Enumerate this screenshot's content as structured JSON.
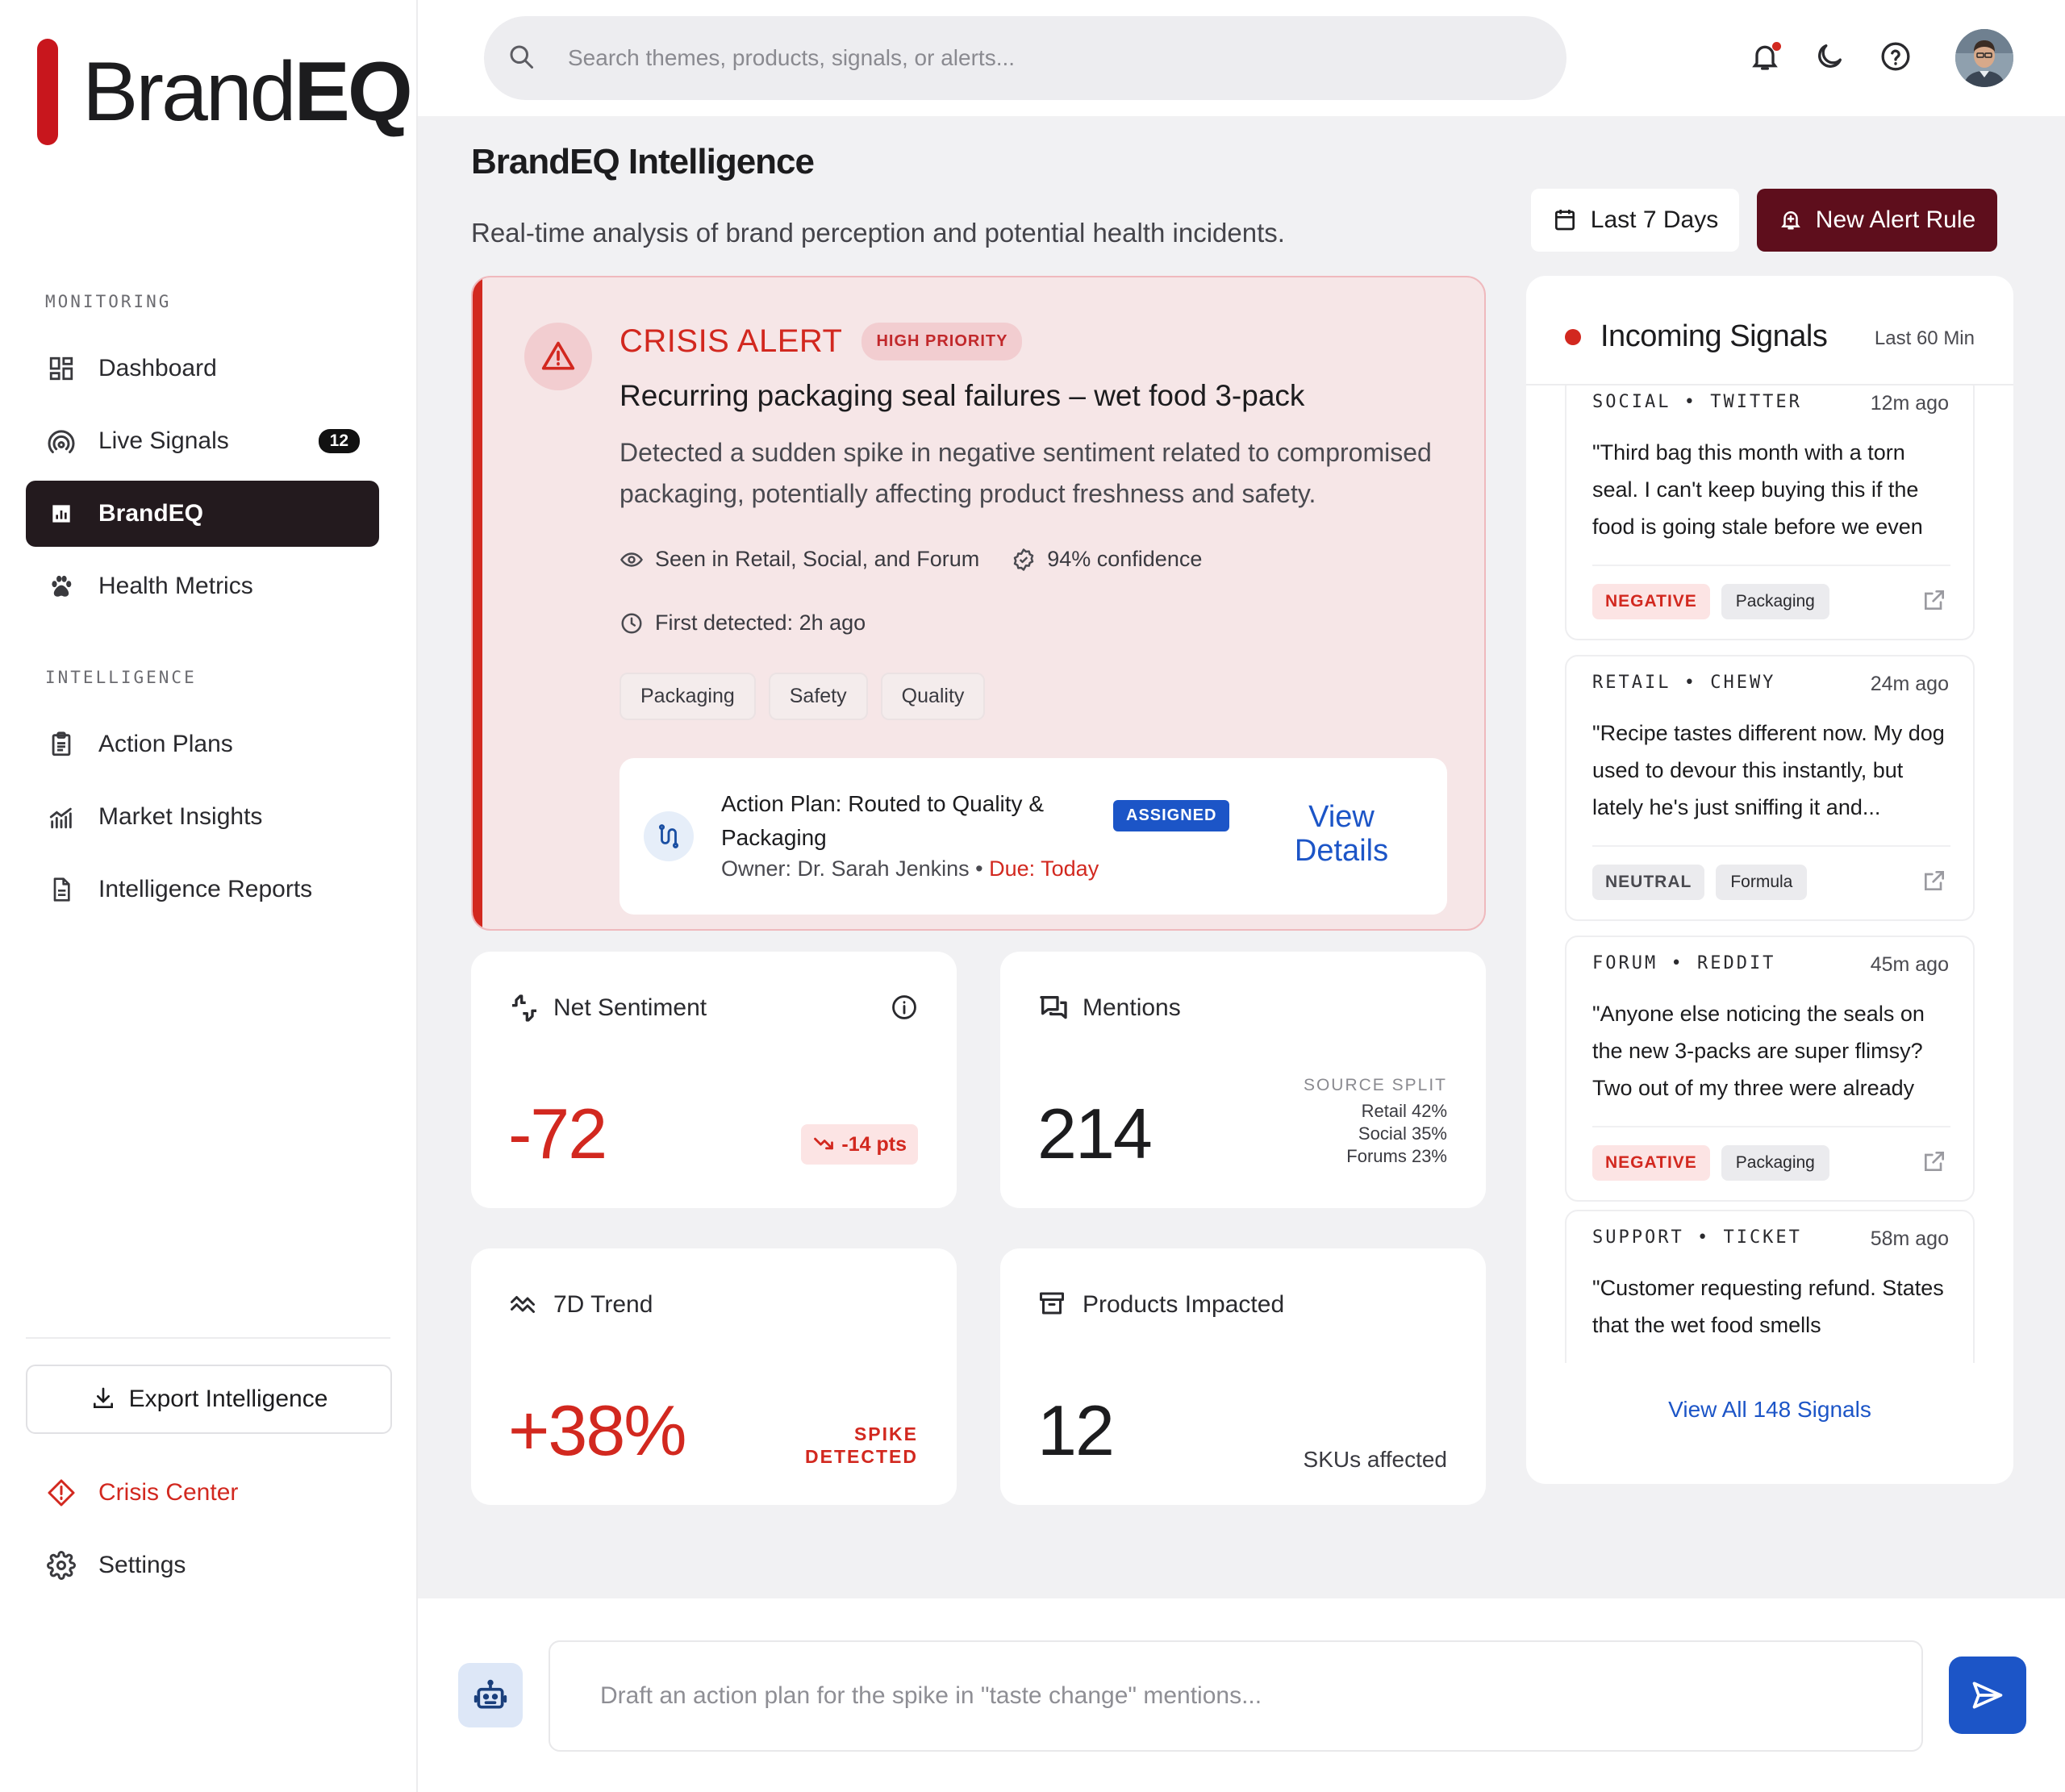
{
  "brand": {
    "name_regular": "Brand",
    "name_bold": "EQ",
    "accent": "#c8161d"
  },
  "sidebar": {
    "monitoring_label": "MONITORING",
    "intelligence_label": "INTELLIGENCE",
    "monitoring_items": [
      {
        "label": "Dashboard",
        "icon": "dashboard-icon"
      },
      {
        "label": "Live Signals",
        "icon": "signal-icon",
        "badge": "12"
      },
      {
        "label": "BrandEQ",
        "icon": "bar-chart-icon",
        "active": true
      },
      {
        "label": "Health Metrics",
        "icon": "paw-icon"
      }
    ],
    "intelligence_items": [
      {
        "label": "Action Plans",
        "icon": "clipboard-icon"
      },
      {
        "label": "Market Insights",
        "icon": "trend-chart-icon"
      },
      {
        "label": "Intelligence Reports",
        "icon": "document-icon"
      }
    ],
    "export_label": "Export Intelligence",
    "crisis_label": "Crisis Center",
    "settings_label": "Settings"
  },
  "topbar": {
    "search_placeholder": "Search themes, products, signals, or alerts...",
    "icons": [
      "bell-icon",
      "moon-icon",
      "help-icon"
    ]
  },
  "header": {
    "title_regular": "Brand",
    "title_bold": "EQ",
    "title_rest": " Intelligence",
    "subtitle": "Real-time analysis of brand perception and potential health incidents.",
    "date_range": "Last 7 Days",
    "new_alert_label": "New Alert Rule"
  },
  "crisis": {
    "title": "CRISIS ALERT",
    "priority": "HIGH PRIORITY",
    "headline": "Recurring packaging seal failures – wet food 3-pack",
    "description": "Detected a sudden spike in negative sentiment related to compromised packaging, potentially affecting product freshness and safety.",
    "seen_in": "Seen in Retail, Social, and Forum",
    "confidence": "94% confidence",
    "first_detected": "First detected: 2h ago",
    "tags": [
      "Packaging",
      "Safety",
      "Quality"
    ],
    "plan": {
      "title": "Action Plan: Routed to Quality & Packaging",
      "owner": "Owner: Dr. Sarah Jenkins • ",
      "due": "Due: Today",
      "status": "ASSIGNED",
      "cta": "View Details"
    }
  },
  "kpis": {
    "sentiment": {
      "label": "Net Sentiment",
      "value": "-72",
      "delta": "-14 pts"
    },
    "mentions": {
      "label": "Mentions",
      "value": "214",
      "split_label": "SOURCE SPLIT",
      "split": [
        "Retail 42%",
        "Social 35%",
        "Forums 23%"
      ]
    },
    "trend": {
      "label": "7D Trend",
      "value": "+38%",
      "status_line1": "SPIKE",
      "status_line2": "DETECTED"
    },
    "products": {
      "label": "Products Impacted",
      "value": "12",
      "unit": "SKUs affected"
    }
  },
  "signals": {
    "title": "Incoming Signals",
    "window": "Last 60 Min",
    "items": [
      {
        "source": "SOCIAL • TWITTER",
        "time": "12m ago",
        "quote": "\"Third bag this month with a torn seal. I can't keep buying this if the food is going stale before we even",
        "sentiment": "NEGATIVE",
        "topic": "Packaging"
      },
      {
        "source": "RETAIL • CHEWY",
        "time": "24m ago",
        "quote": "\"Recipe tastes different now. My dog used to devour this instantly, but lately he's just sniffing it and...",
        "sentiment": "NEUTRAL",
        "topic": "Formula"
      },
      {
        "source": "FORUM • REDDIT",
        "time": "45m ago",
        "quote": "\"Anyone else noticing the seals on the new 3-packs are super flimsy? Two out of my three were already",
        "sentiment": "NEGATIVE",
        "topic": "Packaging"
      },
      {
        "source": "SUPPORT • TICKET",
        "time": "58m ago",
        "quote": "\"Customer requesting refund. States that the wet food smells",
        "sentiment": "",
        "topic": ""
      }
    ],
    "view_all": "View All 148 Signals"
  },
  "chat": {
    "placeholder": "Draft an action plan for the spike in \"taste change\" mentions..."
  },
  "colors": {
    "danger": "#d2281f",
    "primary": "#1c55c7",
    "alert_button": "#5e0e1c",
    "active_nav": "#231a1e"
  }
}
